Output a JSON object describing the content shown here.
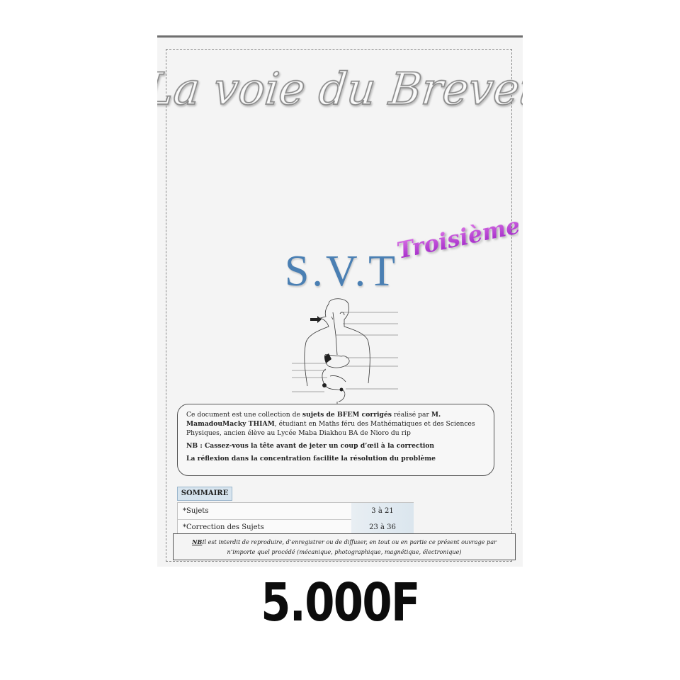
{
  "cover": {
    "title": "La voie du Brevet",
    "grade": "Troisième",
    "subject": "S.V.T",
    "info": {
      "line1_pre": "Ce document est une collection de ",
      "line1_bold": "sujets de BFEM corrigés",
      "line1_mid": " réalisé par ",
      "author": "M. MamadouMacky THIAM",
      "line1_post": ", étudiant en Maths féru des Mathématiques et des Sciences Physiques, ancien élève au Lycée Maba Diakhou BA de Nioro du rip",
      "nb": "NB : Cassez-vous la tête avant de jeter un coup d’œil à la correction",
      "reflexion": "La réflexion dans la concentration facilite la résolution du problème"
    },
    "summary": {
      "heading": "SOMMAIRE",
      "rows": [
        {
          "label": "*Sujets",
          "pages": "3 à 21"
        },
        {
          "label": "*Correction des Sujets",
          "pages": "23 à 36"
        }
      ]
    },
    "copyright": {
      "nb": "NB",
      "text": "Il est interdit de reproduire, d’enregistrer ou de diffuser, en tout ou en partie ce présent ouvrage par n’importe quel procédé (mécanique, photographique, magnétique, électronique)"
    }
  },
  "price": "5.000F",
  "colors": {
    "subject": "#4a7fb3",
    "grade": "#c040d8",
    "title_outline": "#8c8c8c"
  }
}
